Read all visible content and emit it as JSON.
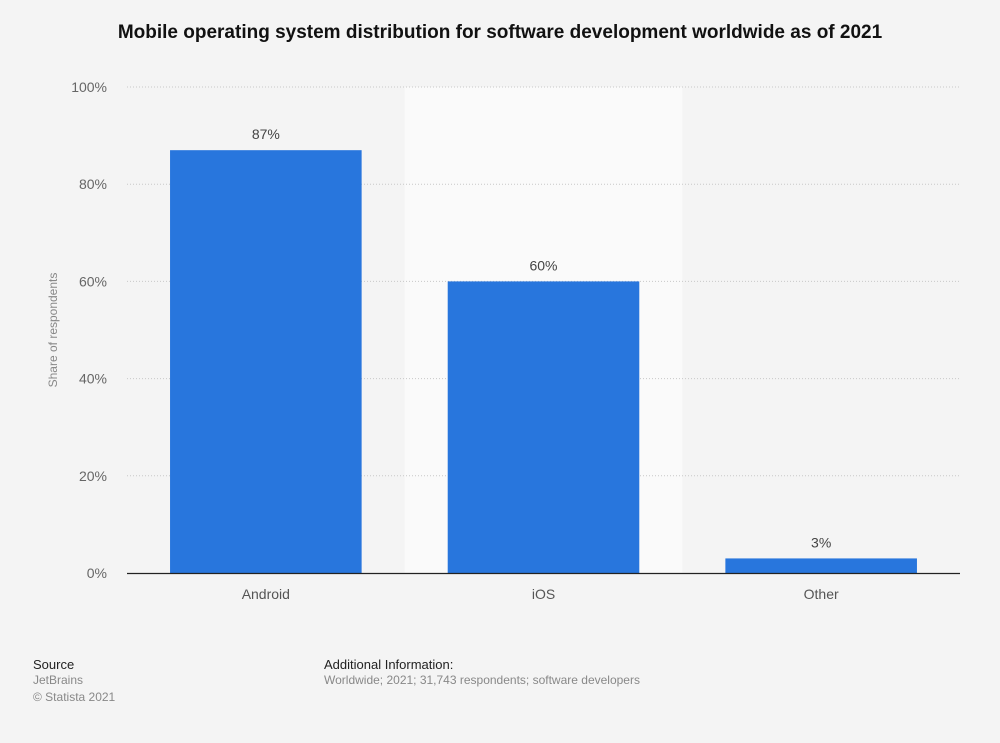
{
  "chart_data": {
    "type": "bar",
    "title": "Mobile operating system distribution for software development worldwide as of 2021",
    "xlabel": "",
    "ylabel": "Share of respondents",
    "categories": [
      "Android",
      "iOS",
      "Other"
    ],
    "values": [
      87,
      60,
      3
    ],
    "data_labels": [
      "87%",
      "60%",
      "3%"
    ],
    "ylim": [
      0,
      100
    ],
    "yticks": [
      0,
      20,
      40,
      60,
      80,
      100
    ],
    "ytick_labels": [
      "0%",
      "20%",
      "40%",
      "60%",
      "80%",
      "100%"
    ],
    "grid": true,
    "bar_color": "#2876dd"
  },
  "footer": {
    "source_heading": "Source",
    "source_name": "JetBrains",
    "copyright": "© Statista 2021",
    "additional_heading": "Additional Information:",
    "additional_text": "Worldwide; 2021; 31,743 respondents; software developers"
  }
}
